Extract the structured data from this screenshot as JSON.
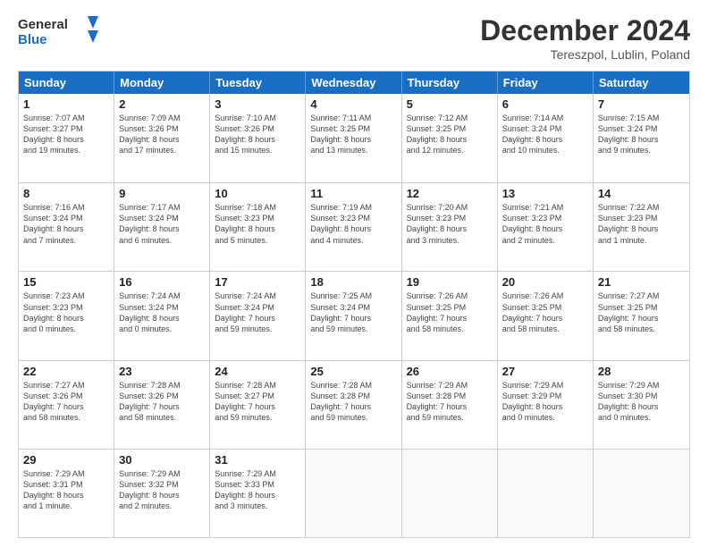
{
  "header": {
    "logo_line1": "General",
    "logo_line2": "Blue",
    "month_title": "December 2024",
    "location": "Tereszpol, Lublin, Poland"
  },
  "weekdays": [
    "Sunday",
    "Monday",
    "Tuesday",
    "Wednesday",
    "Thursday",
    "Friday",
    "Saturday"
  ],
  "weeks": [
    [
      {
        "day": "1",
        "info": "Sunrise: 7:07 AM\nSunset: 3:27 PM\nDaylight: 8 hours\nand 19 minutes."
      },
      {
        "day": "2",
        "info": "Sunrise: 7:09 AM\nSunset: 3:26 PM\nDaylight: 8 hours\nand 17 minutes."
      },
      {
        "day": "3",
        "info": "Sunrise: 7:10 AM\nSunset: 3:26 PM\nDaylight: 8 hours\nand 15 minutes."
      },
      {
        "day": "4",
        "info": "Sunrise: 7:11 AM\nSunset: 3:25 PM\nDaylight: 8 hours\nand 13 minutes."
      },
      {
        "day": "5",
        "info": "Sunrise: 7:12 AM\nSunset: 3:25 PM\nDaylight: 8 hours\nand 12 minutes."
      },
      {
        "day": "6",
        "info": "Sunrise: 7:14 AM\nSunset: 3:24 PM\nDaylight: 8 hours\nand 10 minutes."
      },
      {
        "day": "7",
        "info": "Sunrise: 7:15 AM\nSunset: 3:24 PM\nDaylight: 8 hours\nand 9 minutes."
      }
    ],
    [
      {
        "day": "8",
        "info": "Sunrise: 7:16 AM\nSunset: 3:24 PM\nDaylight: 8 hours\nand 7 minutes."
      },
      {
        "day": "9",
        "info": "Sunrise: 7:17 AM\nSunset: 3:24 PM\nDaylight: 8 hours\nand 6 minutes."
      },
      {
        "day": "10",
        "info": "Sunrise: 7:18 AM\nSunset: 3:23 PM\nDaylight: 8 hours\nand 5 minutes."
      },
      {
        "day": "11",
        "info": "Sunrise: 7:19 AM\nSunset: 3:23 PM\nDaylight: 8 hours\nand 4 minutes."
      },
      {
        "day": "12",
        "info": "Sunrise: 7:20 AM\nSunset: 3:23 PM\nDaylight: 8 hours\nand 3 minutes."
      },
      {
        "day": "13",
        "info": "Sunrise: 7:21 AM\nSunset: 3:23 PM\nDaylight: 8 hours\nand 2 minutes."
      },
      {
        "day": "14",
        "info": "Sunrise: 7:22 AM\nSunset: 3:23 PM\nDaylight: 8 hours\nand 1 minute."
      }
    ],
    [
      {
        "day": "15",
        "info": "Sunrise: 7:23 AM\nSunset: 3:23 PM\nDaylight: 8 hours\nand 0 minutes."
      },
      {
        "day": "16",
        "info": "Sunrise: 7:24 AM\nSunset: 3:24 PM\nDaylight: 8 hours\nand 0 minutes."
      },
      {
        "day": "17",
        "info": "Sunrise: 7:24 AM\nSunset: 3:24 PM\nDaylight: 7 hours\nand 59 minutes."
      },
      {
        "day": "18",
        "info": "Sunrise: 7:25 AM\nSunset: 3:24 PM\nDaylight: 7 hours\nand 59 minutes."
      },
      {
        "day": "19",
        "info": "Sunrise: 7:26 AM\nSunset: 3:25 PM\nDaylight: 7 hours\nand 58 minutes."
      },
      {
        "day": "20",
        "info": "Sunrise: 7:26 AM\nSunset: 3:25 PM\nDaylight: 7 hours\nand 58 minutes."
      },
      {
        "day": "21",
        "info": "Sunrise: 7:27 AM\nSunset: 3:25 PM\nDaylight: 7 hours\nand 58 minutes."
      }
    ],
    [
      {
        "day": "22",
        "info": "Sunrise: 7:27 AM\nSunset: 3:26 PM\nDaylight: 7 hours\nand 58 minutes."
      },
      {
        "day": "23",
        "info": "Sunrise: 7:28 AM\nSunset: 3:26 PM\nDaylight: 7 hours\nand 58 minutes."
      },
      {
        "day": "24",
        "info": "Sunrise: 7:28 AM\nSunset: 3:27 PM\nDaylight: 7 hours\nand 59 minutes."
      },
      {
        "day": "25",
        "info": "Sunrise: 7:28 AM\nSunset: 3:28 PM\nDaylight: 7 hours\nand 59 minutes."
      },
      {
        "day": "26",
        "info": "Sunrise: 7:29 AM\nSunset: 3:28 PM\nDaylight: 7 hours\nand 59 minutes."
      },
      {
        "day": "27",
        "info": "Sunrise: 7:29 AM\nSunset: 3:29 PM\nDaylight: 8 hours\nand 0 minutes."
      },
      {
        "day": "28",
        "info": "Sunrise: 7:29 AM\nSunset: 3:30 PM\nDaylight: 8 hours\nand 0 minutes."
      }
    ],
    [
      {
        "day": "29",
        "info": "Sunrise: 7:29 AM\nSunset: 3:31 PM\nDaylight: 8 hours\nand 1 minute."
      },
      {
        "day": "30",
        "info": "Sunrise: 7:29 AM\nSunset: 3:32 PM\nDaylight: 8 hours\nand 2 minutes."
      },
      {
        "day": "31",
        "info": "Sunrise: 7:29 AM\nSunset: 3:33 PM\nDaylight: 8 hours\nand 3 minutes."
      },
      {
        "day": "",
        "info": ""
      },
      {
        "day": "",
        "info": ""
      },
      {
        "day": "",
        "info": ""
      },
      {
        "day": "",
        "info": ""
      }
    ]
  ]
}
